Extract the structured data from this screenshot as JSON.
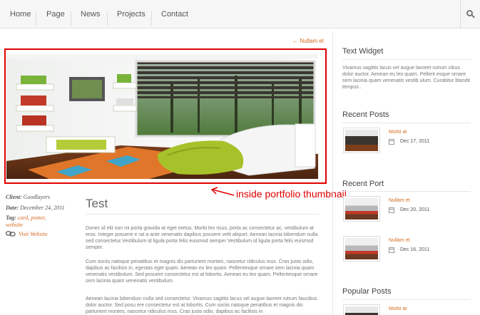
{
  "nav": {
    "items": [
      "Home",
      "Page",
      "News",
      "Projects",
      "Contact"
    ]
  },
  "breadcrumb": "← Nullam et",
  "annotation": "inside portfolio thumbnail",
  "meta": {
    "client_label": "Client:",
    "client": "Goodlayers",
    "date_label": "Date:",
    "date": "December 24, 2011",
    "tag_label": "Tag:",
    "tags": "card, poster,",
    "tags2": "website",
    "visit": "Visit Website"
  },
  "post": {
    "title": "Test",
    "paragraphs": [
      "Donec id elit non mi porta gravida at eget metus. Morbi leo risus, porta ac consectetur ac, vestibulum at eros. Integer posuere e rat a ante venenatis dapibus posuere velit aliquet. Aenean lacinia bibendum nulla sed consectetur.Vestibulum id ligula porta felis euismod semper Vestibulum id ligula porta felis euismod semper.",
      "Cum sociis natoque penatibus et magnis dis parturient montes, nascetur ridiculus mus. Cras justo odio, dapibus ac facilisis in, egestas eget quam. Aenean eu leo quam. Pellentesque ornare sem lacinia quam venenatis vestibulum. Sed posuere consectetur est at lobortis. Aenean eu leo quam. Pellentesque ornare sem lacinia quam venenatis vestibulum.",
      "Aenean lacinia bibendum nulla sed consectetur. Vivamus sagittis lacus vel augue laoreet rutrum faucibus dolor auctor. Sed posu ere consectetur est at lobortis. Cum sociis natoque penatibus et magnis dis parturient montes, nascetur ridiculus mus. Cras justo odio, dapibus ac facilisis in"
    ]
  },
  "sidebar": {
    "text_widget": {
      "title": "Text Widget",
      "body": "Vivamus sagittis lacus vel augue laoreet rutrum cibus dolor auctor. Aenean eu leo quam. Pellent esque ornare sem lacinia quam venenatis vestib ulum. Curabitur blandit tempus ."
    },
    "recent_posts": {
      "title": "Recent Posts",
      "items": [
        {
          "link": "Morbi at",
          "date": "Dec 17, 2011"
        }
      ]
    },
    "recent_port": {
      "title": "Recent Port",
      "items": [
        {
          "link": "Nullam et",
          "date": "Dec 20, 2011"
        },
        {
          "link": "Nullam et",
          "date": "Dec 16, 2011"
        }
      ]
    },
    "popular_posts": {
      "title": "Popular Posts",
      "items": [
        {
          "link": "Morbi at"
        }
      ]
    }
  },
  "colors": {
    "accent": "#d26a1f",
    "annotation": "#e00000"
  }
}
